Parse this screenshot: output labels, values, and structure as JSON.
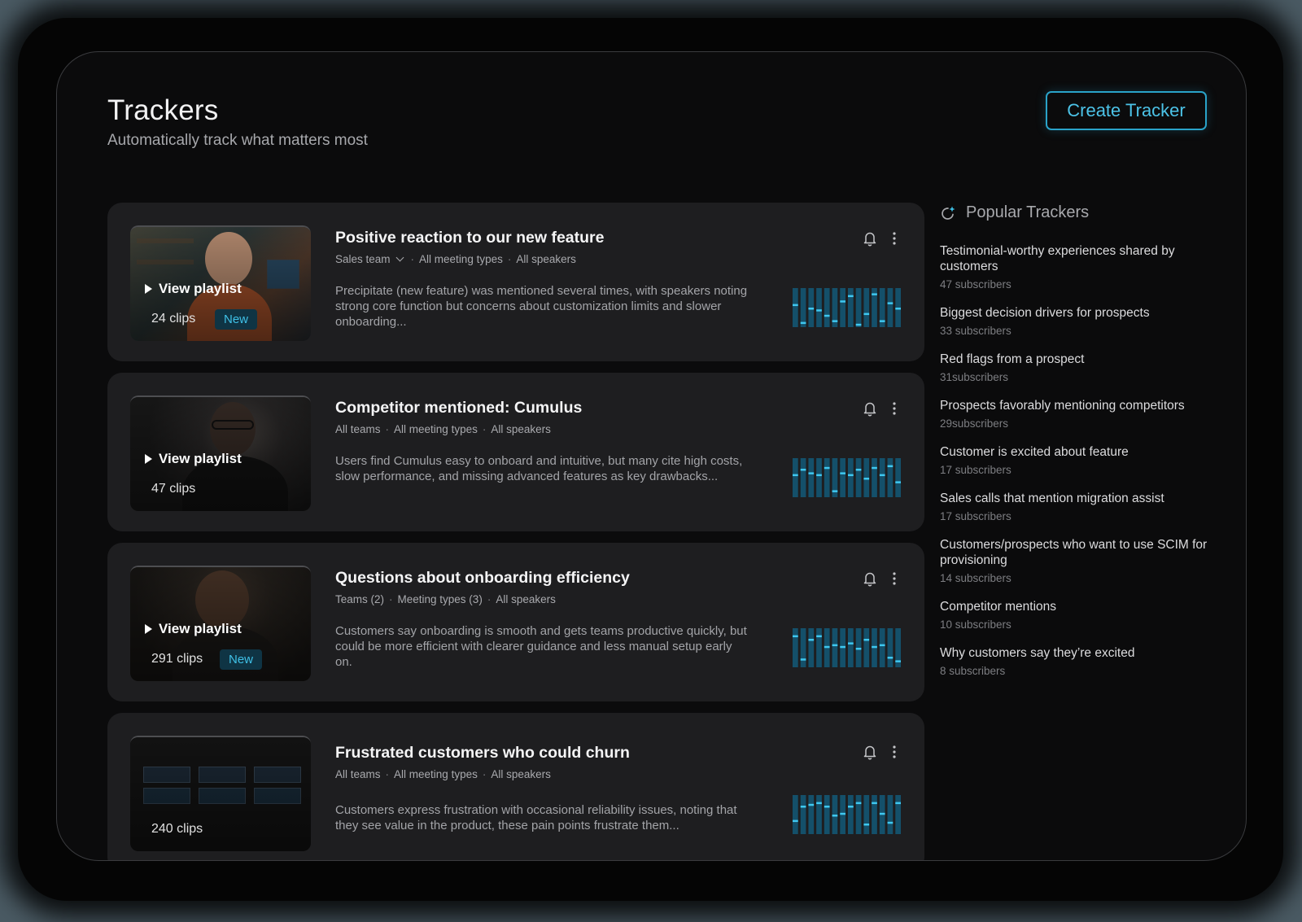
{
  "header": {
    "title": "Trackers",
    "subtitle": "Automatically track what matters most",
    "create_button": "Create Tracker"
  },
  "colors": {
    "accent": "#2aa3c9",
    "spark_bar": "#14506a",
    "spark_tick": "#3fc8f0"
  },
  "trackers": [
    {
      "title": "Positive reaction to our new feature",
      "team": "Sales team",
      "meeting_types": "All meeting types",
      "speakers": "All speakers",
      "description": "Precipitate (new feature) was mentioned several times, with speakers noting strong core function but concerns about customization limits and slower onboarding...",
      "play_label": "View playlist",
      "clips": "24 clips",
      "badge": "New",
      "spark": [
        0.6,
        0.1,
        0.5,
        0.45,
        0.3,
        0.15,
        0.7,
        0.85,
        0.05,
        0.35,
        0.9,
        0.15,
        0.65,
        0.5
      ]
    },
    {
      "title": "Competitor mentioned: Cumulus",
      "team": "All teams",
      "meeting_types": "All meeting types",
      "speakers": "All speakers",
      "description": "Users find Cumulus easy to onboard and intuitive, but many cite high costs, slow performance, and missing advanced features as key drawbacks...",
      "play_label": "View playlist",
      "clips": "47 clips",
      "badge": "",
      "spark": [
        0.6,
        0.75,
        0.65,
        0.6,
        0.8,
        0.15,
        0.65,
        0.6,
        0.75,
        0.5,
        0.8,
        0.6,
        0.85,
        0.4
      ]
    },
    {
      "title": "Questions about onboarding efficiency",
      "team": "Teams (2)",
      "meeting_types": "Meeting types (3)",
      "speakers": "All speakers",
      "description": "Customers say onboarding is smooth and gets teams productive quickly, but could be more efficient with clearer guidance and less manual setup early on.",
      "play_label": "View playlist",
      "clips": "291 clips",
      "badge": "New",
      "spark": [
        0.85,
        0.2,
        0.75,
        0.85,
        0.55,
        0.6,
        0.55,
        0.65,
        0.5,
        0.75,
        0.55,
        0.6,
        0.25,
        0.15
      ]
    },
    {
      "title": "Frustrated customers who could churn",
      "team": "All teams",
      "meeting_types": "All meeting types",
      "speakers": "All speakers",
      "description": "Customers express frustration with occasional reliability issues, noting that they see value in the product, these pain points frustrate them...",
      "play_label": "",
      "clips": "240 clips",
      "badge": "",
      "spark": [
        0.35,
        0.75,
        0.8,
        0.85,
        0.75,
        0.5,
        0.55,
        0.75,
        0.85,
        0.25,
        0.85,
        0.55,
        0.3,
        0.85
      ]
    }
  ],
  "popular": {
    "title": "Popular Trackers",
    "items": [
      {
        "name": "Testimonial-worthy experiences shared by customers",
        "subscribers": "47 subscribers"
      },
      {
        "name": "Biggest decision drivers for prospects",
        "subscribers": "33 subscribers"
      },
      {
        "name": "Red flags from a prospect",
        "subscribers": "31subscribers"
      },
      {
        "name": "Prospects favorably mentioning competitors",
        "subscribers": "29subscribers"
      },
      {
        "name": "Customer is excited about feature",
        "subscribers": "17 subscribers"
      },
      {
        "name": "Sales calls that mention migration assist",
        "subscribers": "17 subscribers"
      },
      {
        "name": "Customers/prospects who want to use SCIM for provisioning",
        "subscribers": "14 subscribers"
      },
      {
        "name": "Competitor mentions",
        "subscribers": "10 subscribers"
      },
      {
        "name": "Why customers say they’re excited",
        "subscribers": "8 subscribers"
      }
    ]
  }
}
